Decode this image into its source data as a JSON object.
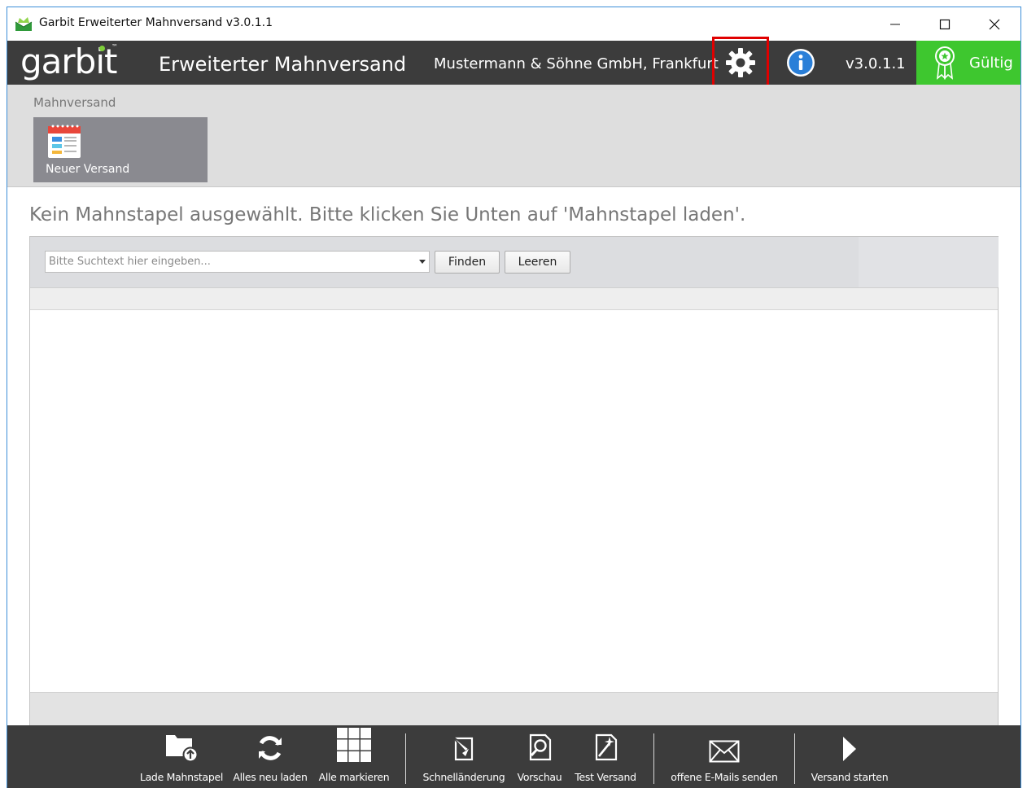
{
  "window": {
    "title": "Garbit Erweiterter Mahnversand v3.0.1.1",
    "controls": {
      "minimize": "minimize-icon",
      "maximize": "maximize-icon",
      "close": "close-icon"
    }
  },
  "header": {
    "logo_text": "garbit",
    "logo_tm": "™",
    "app_name": "Erweiterter Mahnversand",
    "company": "Mustermann & Söhne GmbH, Frankfurt",
    "version": "v3.0.1.1",
    "license_label": "Gültig",
    "colors": {
      "background": "#3c3c3c",
      "license": "#3ec72f",
      "highlight": "#e00000"
    }
  },
  "ribbon": {
    "group_label": "Mahnversand",
    "new_button_label": "Neuer Versand"
  },
  "message": "Kein Mahnstapel ausgewählt. Bitte klicken Sie Unten auf 'Mahnstapel laden'.",
  "search": {
    "placeholder": "Bitte Suchtext hier eingeben...",
    "value": "",
    "find_label": "Finden",
    "clear_label": "Leeren"
  },
  "toolbar": {
    "items": [
      {
        "label": "Lade Mahnstapel",
        "icon": "folder-upload-icon"
      },
      {
        "label": "Alles neu laden",
        "icon": "refresh-icon"
      },
      {
        "label": "Alle markieren",
        "icon": "grid-select-icon"
      },
      {
        "label": "Schnelländerung",
        "icon": "quick-edit-icon"
      },
      {
        "label": "Vorschau",
        "icon": "preview-icon"
      },
      {
        "label": "Test Versand",
        "icon": "test-send-icon"
      },
      {
        "label": "offene E-Mails senden",
        "icon": "mail-icon"
      },
      {
        "label": "Versand starten",
        "icon": "play-icon"
      }
    ]
  }
}
